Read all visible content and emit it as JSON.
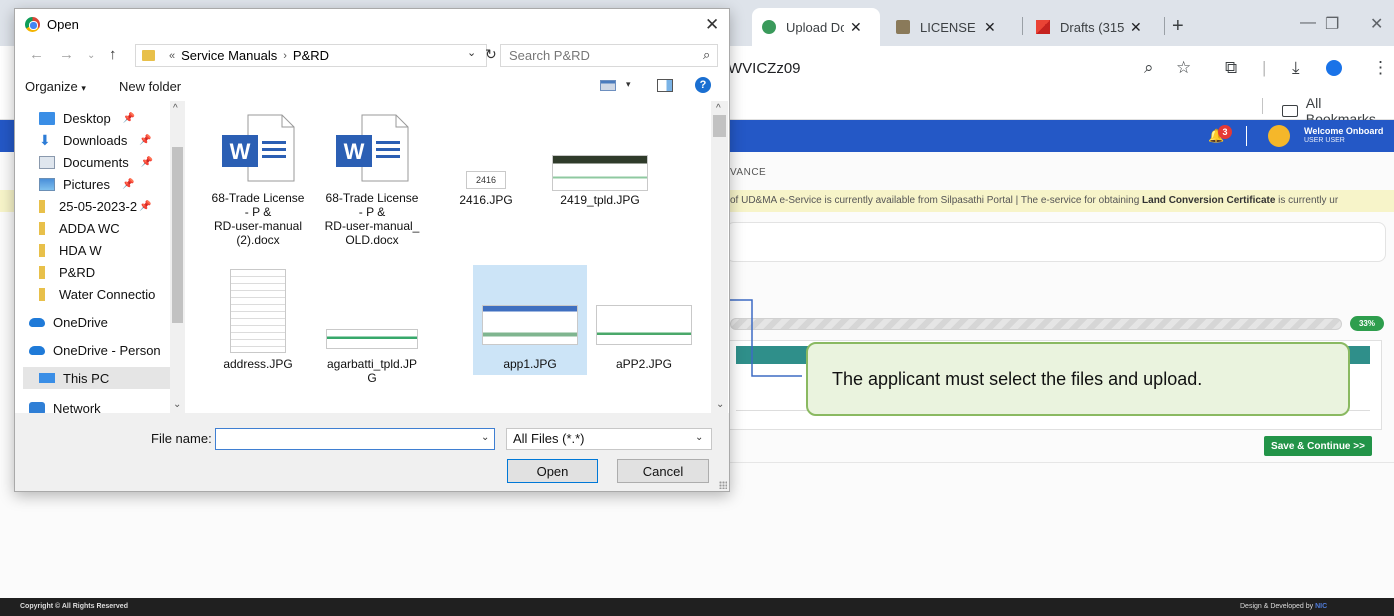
{
  "browser": {
    "tabs": [
      {
        "label": "Upload Dc",
        "active": true
      },
      {
        "label": "LICENSE U",
        "active": false
      },
      {
        "label": "Drafts (315",
        "active": false
      }
    ],
    "url_fragment": "WVICZz09",
    "all_bookmarks": "All Bookmarks"
  },
  "webpage": {
    "welcome": "Welcome Onboard",
    "welcome_user": "USER USER",
    "notification_count": "3",
    "menu_item": "VANCE",
    "ticker_text": "of UD&MA e-Service is currently available from Silpasathi Portal | The e-service for obtaining ",
    "ticker_bold": "Land Conversion Certificate",
    "ticker_tail": " is currently ur",
    "progress_label": "33%",
    "progress_value": 0.33,
    "save_button": "Save & Continue >>",
    "copyright": "Copyright © All Rights Reserved",
    "designed_by": "Design & Developed by",
    "designed_brand": "NIC"
  },
  "callout": {
    "text": "The applicant must select the files and upload."
  },
  "dialog": {
    "title": "Open",
    "breadcrumb": [
      "Service Manuals",
      "P&RD"
    ],
    "search_placeholder": "Search P&RD",
    "organize": "Organize",
    "new_folder": "New folder",
    "sidebar": [
      {
        "label": "Desktop",
        "pinned": true
      },
      {
        "label": "Downloads",
        "pinned": true
      },
      {
        "label": "Documents",
        "pinned": true
      },
      {
        "label": "Pictures",
        "pinned": true
      },
      {
        "label": "25-05-2023-2",
        "pinned": true
      },
      {
        "label": "ADDA WC",
        "pinned": false
      },
      {
        "label": "HDA W",
        "pinned": false
      },
      {
        "label": "P&RD",
        "pinned": false
      },
      {
        "label": "Water Connectio",
        "pinned": false
      },
      {
        "label": "OneDrive",
        "pinned": false
      },
      {
        "label": "OneDrive - Person",
        "pinned": false
      },
      {
        "label": "This PC",
        "pinned": false
      },
      {
        "label": "Network",
        "pinned": false
      }
    ],
    "files": [
      {
        "name": "68-Trade License - P & RD-user-manual (2).docx",
        "line1": "68-Trade License",
        "line2": "- P &",
        "line3": "RD-user-manual",
        "line4": "(2).docx",
        "kind": "word"
      },
      {
        "name": "68-Trade License - P & RD-user-manual_OLD.docx",
        "line1": "68-Trade License",
        "line2": "- P &",
        "line3": "RD-user-manual_",
        "line4": "OLD.docx",
        "kind": "word"
      },
      {
        "name": "2416.JPG",
        "line1": "2416.JPG",
        "kind": "image",
        "thumb_text": "2416"
      },
      {
        "name": "2419_tpld.JPG",
        "line1": "2419_tpld.JPG",
        "kind": "image"
      },
      {
        "name": "address.JPG",
        "line1": "address.JPG",
        "kind": "image"
      },
      {
        "name": "agarbatti_tpld.JPG",
        "line1": "agarbatti_tpld.JP",
        "line2": "G",
        "kind": "image"
      },
      {
        "name": "app1.JPG",
        "line1": "app1.JPG",
        "kind": "image",
        "selected": true
      },
      {
        "name": "aPP2.JPG",
        "line1": "aPP2.JPG",
        "kind": "image"
      }
    ],
    "file_name_label": "File name:",
    "file_name_value": "",
    "file_type": "All Files (*.*)",
    "open_button": "Open",
    "cancel_button": "Cancel"
  }
}
